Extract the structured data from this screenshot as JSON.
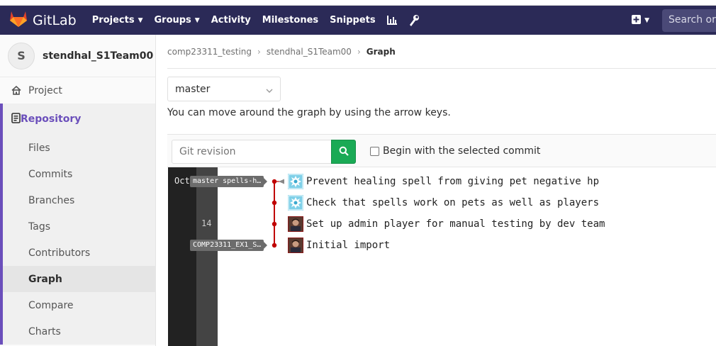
{
  "navbar": {
    "brand": "GitLab",
    "items": [
      {
        "label": "Projects",
        "dropdown": true
      },
      {
        "label": "Groups",
        "dropdown": true
      },
      {
        "label": "Activity",
        "dropdown": false
      },
      {
        "label": "Milestones",
        "dropdown": false
      },
      {
        "label": "Snippets",
        "dropdown": false
      }
    ],
    "icons": [
      "chart-icon",
      "wrench-icon"
    ],
    "search_placeholder": "Search or j",
    "bg_color": "#2b2a57"
  },
  "sidebar": {
    "avatar_letter": "S",
    "project_name": "stendhal_S1Team00",
    "project_link": "Project",
    "section": "Repository",
    "items": [
      "Files",
      "Commits",
      "Branches",
      "Tags",
      "Contributors",
      "Graph",
      "Compare",
      "Charts"
    ],
    "active_item": "Graph",
    "accent_color": "#6b4fbb"
  },
  "breadcrumb": {
    "items": [
      "comp23311_testing",
      "stendhal_S1Team00"
    ],
    "current": "Graph"
  },
  "branch": {
    "selected": "master"
  },
  "hint": "You can move around the graph by using the arrow keys.",
  "filter": {
    "placeholder": "Git revision",
    "checkbox_label": "Begin with the selected commit"
  },
  "graph": {
    "month": "Oct",
    "day": "14",
    "refs": [
      {
        "label": "master spells-h…"
      },
      {
        "label": "COMP23311_EX1_S…"
      }
    ],
    "commits": [
      {
        "message": "Prevent healing spell from giving pet negative hp",
        "avatar": "pattern"
      },
      {
        "message": "Check that spells work on pets as well as players",
        "avatar": "pattern"
      },
      {
        "message": "Set up admin player for manual testing by dev team",
        "avatar": "photo"
      },
      {
        "message": "Initial import",
        "avatar": "photo"
      }
    ],
    "line_color": "#c00000"
  }
}
